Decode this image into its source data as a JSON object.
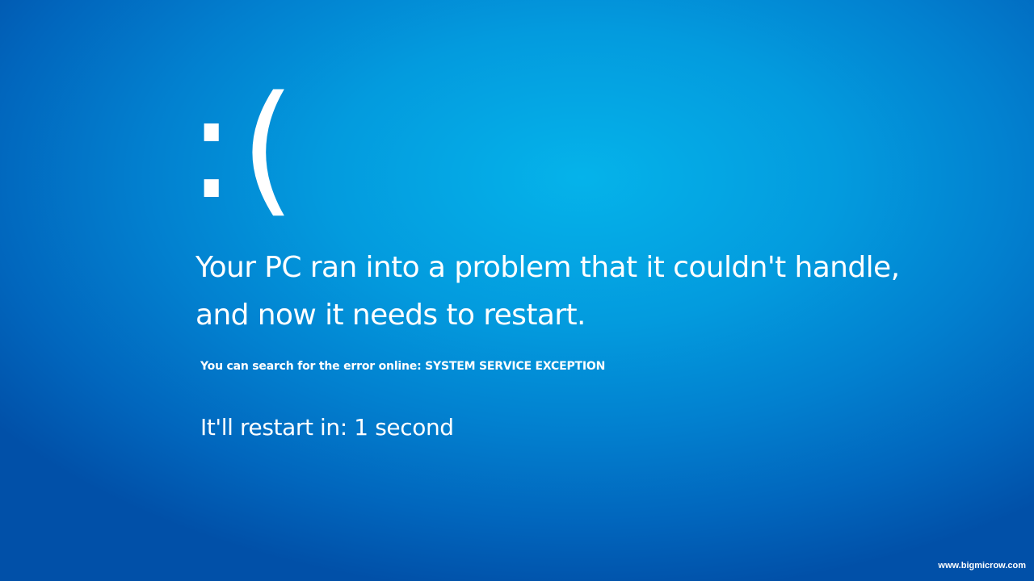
{
  "screen": {
    "emoticon": ":(",
    "headline_line1": "Your PC ran into a problem that it couldn't handle,",
    "headline_line2": "and now it needs to restart.",
    "search_prompt": "You can search for the error online: SYSTEM SERVICE EXCEPTION",
    "restart_countdown": "It'll restart in: 1 second"
  },
  "watermark": {
    "text": "www.bigmicrow.com"
  },
  "colors": {
    "background_center": "#05b3ea",
    "background_edge": "#0150a8",
    "text": "#ffffff"
  }
}
